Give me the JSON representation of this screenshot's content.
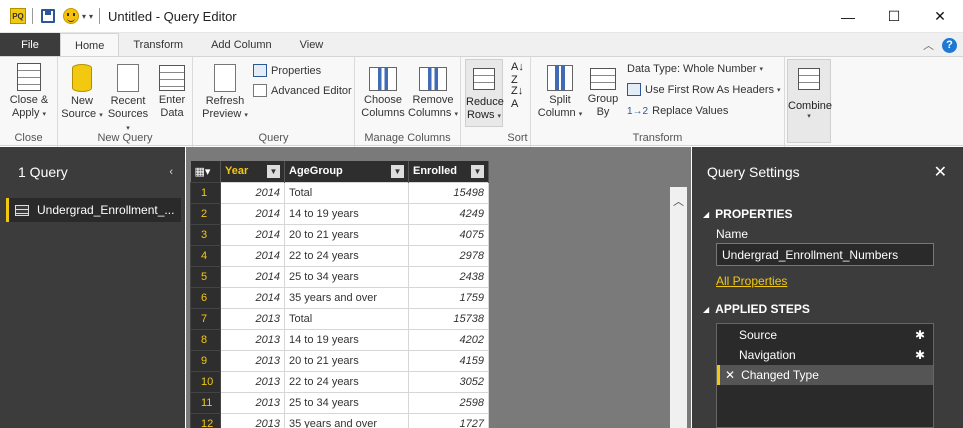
{
  "window": {
    "title": "Untitled - Query Editor",
    "app_badge": "PQ",
    "min": "—",
    "max": "☐",
    "close": "✕"
  },
  "tabs": [
    "File",
    "Home",
    "Transform",
    "Add Column",
    "View"
  ],
  "ribbon": {
    "close_group": {
      "label": "Close",
      "btn1": "Close &",
      "btn2": "Apply"
    },
    "newquery_group": {
      "label": "New Query",
      "new1": "New",
      "new2": "Source",
      "recent1": "Recent",
      "recent2": "Sources",
      "enter1": "Enter",
      "enter2": "Data"
    },
    "query_group": {
      "label": "Query",
      "refresh1": "Refresh",
      "refresh2": "Preview",
      "properties": "Properties",
      "advanced": "Advanced Editor"
    },
    "manage_group": {
      "label": "Manage Columns",
      "choose1": "Choose",
      "choose2": "Columns",
      "remove1": "Remove",
      "remove2": "Columns"
    },
    "reduce": {
      "line1": "Reduce",
      "line2": "Rows"
    },
    "sort_group": {
      "label": "Sort"
    },
    "transform_group": {
      "label": "Transform",
      "split1": "Split",
      "split2": "Column",
      "group1": "Group",
      "group2": "By",
      "datatype": "Data Type: Whole Number",
      "firstrow": "Use First Row As Headers",
      "replace": "Replace Values"
    },
    "combine": {
      "label": "Combine"
    }
  },
  "left_pane": {
    "title": "1 Query",
    "query_name": "Undergrad_Enrollment_..."
  },
  "grid": {
    "columns": [
      "Year",
      "AgeGroup",
      "Enrolled"
    ],
    "rows": [
      [
        "1",
        "2014",
        "Total",
        "15498"
      ],
      [
        "2",
        "2014",
        "14 to 19 years",
        "4249"
      ],
      [
        "3",
        "2014",
        "20 to 21 years",
        "4075"
      ],
      [
        "4",
        "2014",
        "22 to 24 years",
        "2978"
      ],
      [
        "5",
        "2014",
        "25 to 34 years",
        "2438"
      ],
      [
        "6",
        "2014",
        "35 years and over",
        "1759"
      ],
      [
        "7",
        "2013",
        "Total",
        "15738"
      ],
      [
        "8",
        "2013",
        "14 to 19 years",
        "4202"
      ],
      [
        "9",
        "2013",
        "20 to 21 years",
        "4159"
      ],
      [
        "10",
        "2013",
        "22 to 24 years",
        "3052"
      ],
      [
        "11",
        "2013",
        "25 to 34 years",
        "2598"
      ],
      [
        "12",
        "2013",
        "35 years and over",
        "1727"
      ]
    ]
  },
  "query_settings": {
    "title": "Query Settings",
    "properties_heading": "PROPERTIES",
    "name_label": "Name",
    "name_value": "Undergrad_Enrollment_Numbers",
    "all_properties": "All Properties",
    "applied_heading": "APPLIED STEPS",
    "steps": [
      "Source",
      "Navigation",
      "Changed Type"
    ]
  },
  "colors": {
    "accent": "#f2c811",
    "dark_pane": "#3c3c3c",
    "grid_bg": "#7a7a7a"
  }
}
